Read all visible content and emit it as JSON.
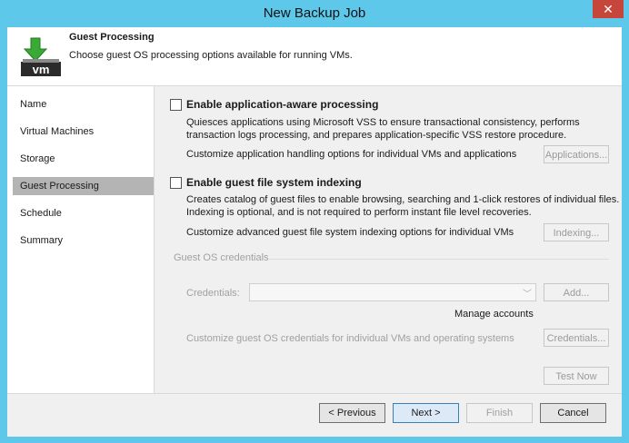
{
  "window": {
    "title": "New Backup Job",
    "close_glyph": "✕"
  },
  "header": {
    "title": "Guest Processing",
    "subtitle": "Choose guest OS processing options available for running VMs.",
    "icon": "vm-download-icon",
    "icon_text": "vm"
  },
  "sidebar": {
    "items": [
      {
        "label": "Name"
      },
      {
        "label": "Virtual Machines"
      },
      {
        "label": "Storage"
      },
      {
        "label": "Guest Processing",
        "active": true
      },
      {
        "label": "Schedule"
      },
      {
        "label": "Summary"
      }
    ]
  },
  "app_aware": {
    "label": "Enable application-aware processing",
    "checked": false,
    "desc1": "Quiesces applications using Microsoft VSS to ensure transactional consistency, performs",
    "desc2": "transaction logs processing, and prepares application-specific VSS restore procedure.",
    "customize": "Customize application handling options for individual VMs and applications",
    "button": "Applications..."
  },
  "indexing": {
    "label": "Enable guest file system indexing",
    "checked": false,
    "desc1": "Creates catalog of guest files to enable browsing, searching and 1-click restores of individual files.",
    "desc2": "Indexing is optional, and is not required to perform instant file level recoveries.",
    "customize": "Customize advanced guest file system indexing options for individual VMs",
    "button": "Indexing..."
  },
  "credentials": {
    "group_label": "Guest OS credentials",
    "label": "Credentials:",
    "value": "",
    "add_button": "Add...",
    "manage_link": "Manage accounts",
    "customize": "Customize guest OS credentials for individual VMs and operating systems",
    "credentials_button": "Credentials...",
    "test_button": "Test Now"
  },
  "footer": {
    "previous": "< Previous",
    "next": "Next >",
    "finish": "Finish",
    "cancel": "Cancel"
  },
  "colors": {
    "titlebar": "#5dc8ea",
    "close": "#c7463c",
    "active_nav": "#b4b4b4"
  }
}
